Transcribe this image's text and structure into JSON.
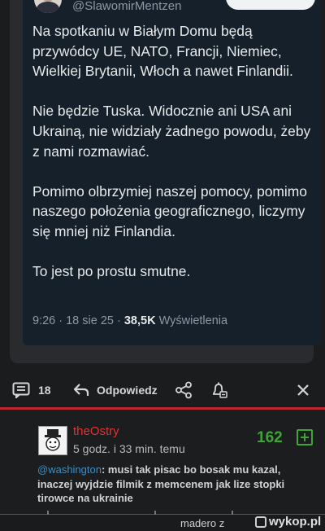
{
  "tweet": {
    "handle": "@SlawomirMentzen",
    "paragraphs": [
      "Na spotkaniu w Białym Domu będą przywódcy UE, NATO, Francji, Niemiec, Wielkiej Brytanii, Włoch a nawet Finlandii.",
      "Nie będzie Tuska. Widocznie ani USA ani Ukrainą, nie widziały żadnego powodu, żeby z nami rozmawiać.",
      "Pomimo olbrzymiej naszej pomocy, pomimo naszego położenia geograficznego, liczymy się mniej niż Finlandia.",
      "To jest po prostu smutne."
    ],
    "time": "9:26 · 18 sie 25 · ",
    "views_count": "38,5K",
    "views_label": " Wyświetlenia"
  },
  "actions": {
    "comments_count": "18",
    "reply_label": "Odpowiedz"
  },
  "comment": {
    "username": "theOstry",
    "time": "5 godz. i 33 min. temu",
    "score": "162",
    "mention": "@washington",
    "text": ": musi tak pisac bo bosak mu kazal, inaczej wyjdzie filmik z memcenem jak lize stopki tirowce na ukrainie"
  },
  "footer": {
    "credit": "madero z",
    "brand": "wykop.pl"
  },
  "colors": {
    "accent_red": "#c0262d",
    "score_green": "#3fa535",
    "mention_blue": "#3b8ec7",
    "tweet_bg": "#15202b"
  }
}
